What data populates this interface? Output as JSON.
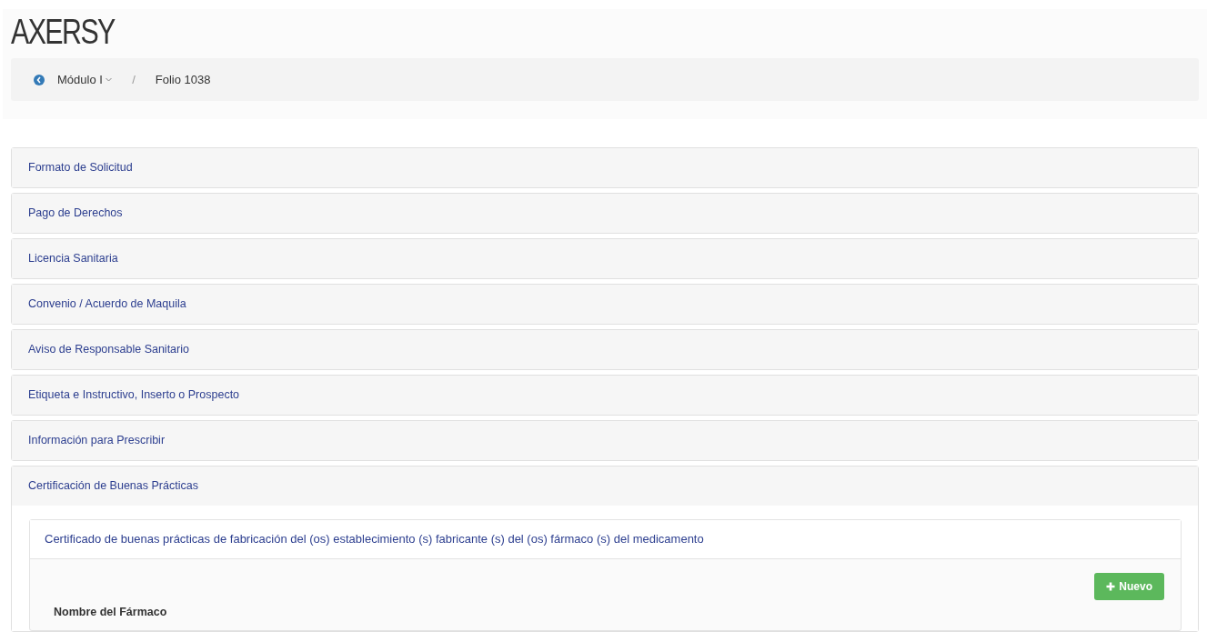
{
  "brand": "AXERSY",
  "breadcrumb": [
    {
      "kind": "dropdown",
      "label": "Módulo I"
    },
    {
      "kind": "separator",
      "label": "/"
    },
    {
      "kind": "text",
      "label": "Folio 1038"
    }
  ],
  "panels": [
    {
      "title": "Formato de Solicitud",
      "expanded": false
    },
    {
      "title": "Pago de Derechos",
      "expanded": false
    },
    {
      "title": "Licencia Sanitaria",
      "expanded": false
    },
    {
      "title": "Convenio / Acuerdo de Maquila",
      "expanded": false
    },
    {
      "title": "Aviso de Responsable Sanitario",
      "expanded": false
    },
    {
      "title": "Etiqueta e Instructivo, Inserto o Prospecto",
      "expanded": false
    },
    {
      "title": "Información para Prescribir",
      "expanded": false
    },
    {
      "title": "Certificación de Buenas Prácticas",
      "expanded": true
    }
  ],
  "subpanel": {
    "title": "Certificado de buenas prácticas de fabricación del (os) establecimiento (s) fabricante (s) del (os) fármaco (s) del medicamento",
    "button": "Nuevo",
    "column": "Nombre del Fármaco"
  }
}
